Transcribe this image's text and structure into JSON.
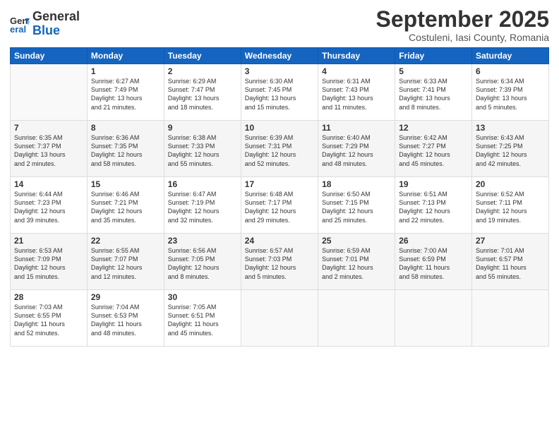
{
  "header": {
    "logo_general": "General",
    "logo_blue": "Blue",
    "month_title": "September 2025",
    "subtitle": "Costuleni, Iasi County, Romania"
  },
  "weekdays": [
    "Sunday",
    "Monday",
    "Tuesday",
    "Wednesday",
    "Thursday",
    "Friday",
    "Saturday"
  ],
  "weeks": [
    [
      {
        "day": "",
        "info": ""
      },
      {
        "day": "1",
        "info": "Sunrise: 6:27 AM\nSunset: 7:49 PM\nDaylight: 13 hours\nand 21 minutes."
      },
      {
        "day": "2",
        "info": "Sunrise: 6:29 AM\nSunset: 7:47 PM\nDaylight: 13 hours\nand 18 minutes."
      },
      {
        "day": "3",
        "info": "Sunrise: 6:30 AM\nSunset: 7:45 PM\nDaylight: 13 hours\nand 15 minutes."
      },
      {
        "day": "4",
        "info": "Sunrise: 6:31 AM\nSunset: 7:43 PM\nDaylight: 13 hours\nand 11 minutes."
      },
      {
        "day": "5",
        "info": "Sunrise: 6:33 AM\nSunset: 7:41 PM\nDaylight: 13 hours\nand 8 minutes."
      },
      {
        "day": "6",
        "info": "Sunrise: 6:34 AM\nSunset: 7:39 PM\nDaylight: 13 hours\nand 5 minutes."
      }
    ],
    [
      {
        "day": "7",
        "info": "Sunrise: 6:35 AM\nSunset: 7:37 PM\nDaylight: 13 hours\nand 2 minutes."
      },
      {
        "day": "8",
        "info": "Sunrise: 6:36 AM\nSunset: 7:35 PM\nDaylight: 12 hours\nand 58 minutes."
      },
      {
        "day": "9",
        "info": "Sunrise: 6:38 AM\nSunset: 7:33 PM\nDaylight: 12 hours\nand 55 minutes."
      },
      {
        "day": "10",
        "info": "Sunrise: 6:39 AM\nSunset: 7:31 PM\nDaylight: 12 hours\nand 52 minutes."
      },
      {
        "day": "11",
        "info": "Sunrise: 6:40 AM\nSunset: 7:29 PM\nDaylight: 12 hours\nand 48 minutes."
      },
      {
        "day": "12",
        "info": "Sunrise: 6:42 AM\nSunset: 7:27 PM\nDaylight: 12 hours\nand 45 minutes."
      },
      {
        "day": "13",
        "info": "Sunrise: 6:43 AM\nSunset: 7:25 PM\nDaylight: 12 hours\nand 42 minutes."
      }
    ],
    [
      {
        "day": "14",
        "info": "Sunrise: 6:44 AM\nSunset: 7:23 PM\nDaylight: 12 hours\nand 39 minutes."
      },
      {
        "day": "15",
        "info": "Sunrise: 6:46 AM\nSunset: 7:21 PM\nDaylight: 12 hours\nand 35 minutes."
      },
      {
        "day": "16",
        "info": "Sunrise: 6:47 AM\nSunset: 7:19 PM\nDaylight: 12 hours\nand 32 minutes."
      },
      {
        "day": "17",
        "info": "Sunrise: 6:48 AM\nSunset: 7:17 PM\nDaylight: 12 hours\nand 29 minutes."
      },
      {
        "day": "18",
        "info": "Sunrise: 6:50 AM\nSunset: 7:15 PM\nDaylight: 12 hours\nand 25 minutes."
      },
      {
        "day": "19",
        "info": "Sunrise: 6:51 AM\nSunset: 7:13 PM\nDaylight: 12 hours\nand 22 minutes."
      },
      {
        "day": "20",
        "info": "Sunrise: 6:52 AM\nSunset: 7:11 PM\nDaylight: 12 hours\nand 19 minutes."
      }
    ],
    [
      {
        "day": "21",
        "info": "Sunrise: 6:53 AM\nSunset: 7:09 PM\nDaylight: 12 hours\nand 15 minutes."
      },
      {
        "day": "22",
        "info": "Sunrise: 6:55 AM\nSunset: 7:07 PM\nDaylight: 12 hours\nand 12 minutes."
      },
      {
        "day": "23",
        "info": "Sunrise: 6:56 AM\nSunset: 7:05 PM\nDaylight: 12 hours\nand 8 minutes."
      },
      {
        "day": "24",
        "info": "Sunrise: 6:57 AM\nSunset: 7:03 PM\nDaylight: 12 hours\nand 5 minutes."
      },
      {
        "day": "25",
        "info": "Sunrise: 6:59 AM\nSunset: 7:01 PM\nDaylight: 12 hours\nand 2 minutes."
      },
      {
        "day": "26",
        "info": "Sunrise: 7:00 AM\nSunset: 6:59 PM\nDaylight: 11 hours\nand 58 minutes."
      },
      {
        "day": "27",
        "info": "Sunrise: 7:01 AM\nSunset: 6:57 PM\nDaylight: 11 hours\nand 55 minutes."
      }
    ],
    [
      {
        "day": "28",
        "info": "Sunrise: 7:03 AM\nSunset: 6:55 PM\nDaylight: 11 hours\nand 52 minutes."
      },
      {
        "day": "29",
        "info": "Sunrise: 7:04 AM\nSunset: 6:53 PM\nDaylight: 11 hours\nand 48 minutes."
      },
      {
        "day": "30",
        "info": "Sunrise: 7:05 AM\nSunset: 6:51 PM\nDaylight: 11 hours\nand 45 minutes."
      },
      {
        "day": "",
        "info": ""
      },
      {
        "day": "",
        "info": ""
      },
      {
        "day": "",
        "info": ""
      },
      {
        "day": "",
        "info": ""
      }
    ]
  ]
}
